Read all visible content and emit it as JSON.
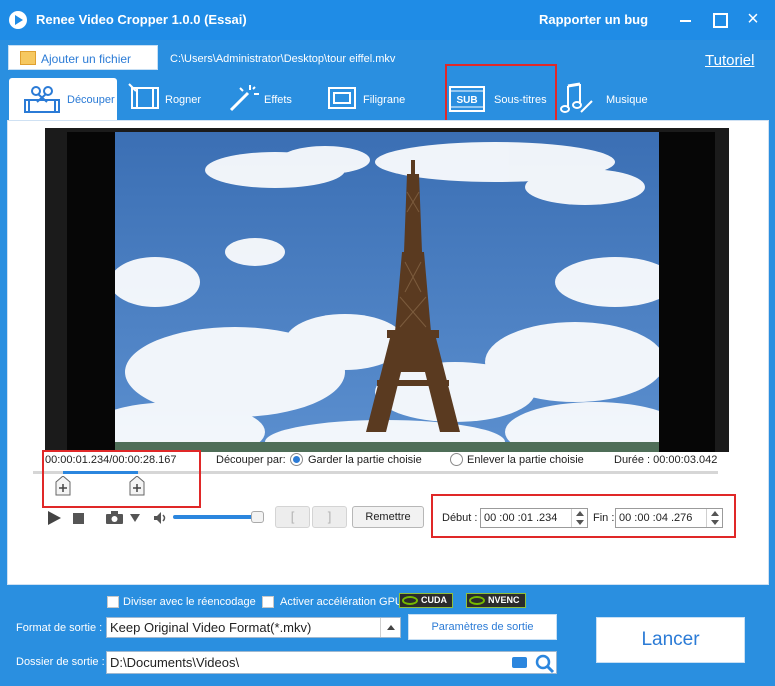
{
  "window": {
    "title": "Renee Video Cropper 1.0.0 (Essai)",
    "report_bug": "Rapporter un bug",
    "close_glyph": "×"
  },
  "toolbar": {
    "add_file": "Ajouter un fichier",
    "file_path": "C:\\Users\\Administrator\\Desktop\\tour eiffel.mkv",
    "tutorial": "Tutoriel"
  },
  "tabs": [
    {
      "label": "Découper",
      "icon": "scissors-film-icon",
      "active": true
    },
    {
      "label": "Rogner",
      "icon": "crop-film-icon",
      "active": false
    },
    {
      "label": "Effets",
      "icon": "magic-wand-icon",
      "active": false
    },
    {
      "label": "Filigrane",
      "icon": "watermark-icon",
      "active": false
    },
    {
      "label": "Sous-titres",
      "icon": "subtitle-icon",
      "active": false
    },
    {
      "label": "Musique",
      "icon": "music-note-icon",
      "active": false
    }
  ],
  "player": {
    "time_readout": "00:00:01.234/00:00:28.167",
    "cut_by_label": "Découper par:",
    "option_keep": "Garder la partie choisie",
    "option_remove": "Enlever la partie choisie",
    "selected_option": "keep",
    "duration": "Durée : 00:00:03.042",
    "selection": {
      "start_seconds": 1.234,
      "end_seconds": 4.276,
      "total_seconds": 28.167
    },
    "volume_fraction": 0.95,
    "bracket_open": "[",
    "bracket_close": "]",
    "reset": "Remettre",
    "start_label": "Début :",
    "start_value": "00 :00 :01 .234",
    "end_label": "Fin :",
    "end_value": "00 :00 :04 .276"
  },
  "options": {
    "split_reencode": "Diviser avec le réencodage",
    "gpu_accel": "Activer accélération GPU",
    "cuda": "CUDA",
    "nvenc": "NVENC"
  },
  "output": {
    "format_label": "Format de sortie :",
    "format_value": "Keep Original Video Format(*.mkv)",
    "params_button": "Paramètres de sortie",
    "folder_label": "Dossier de sortie :",
    "folder_value": "D:\\Documents\\Videos\\",
    "launch": "Lancer"
  },
  "colors": {
    "accent": "#1f8ce6",
    "highlight": "#e02828"
  }
}
